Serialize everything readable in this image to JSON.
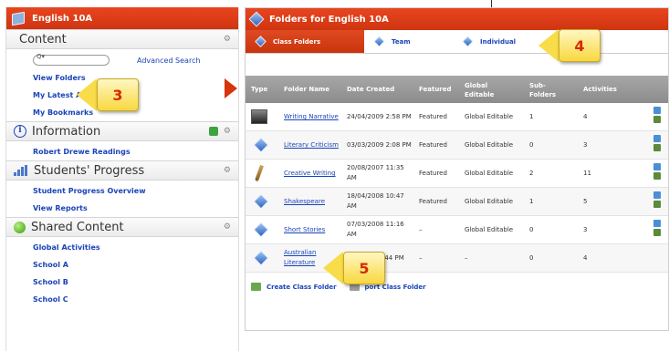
{
  "left_panel": {
    "title": "English 10A",
    "content": {
      "heading": "Content",
      "search_placeholder": "",
      "advanced_search": "Advanced Search",
      "links": [
        "View Folders",
        "My Latest Activities",
        "My Bookmarks"
      ]
    },
    "information": {
      "heading": "Information",
      "links": [
        "Robert Drewe Readings"
      ]
    },
    "progress": {
      "heading": "Students' Progress",
      "links": [
        "Student Progress Overview",
        "View Reports"
      ]
    },
    "shared": {
      "heading": "Shared Content",
      "links": [
        "Global Activities",
        "School A",
        "School B",
        "School C"
      ]
    }
  },
  "callouts": {
    "c3": "3",
    "c4": "4",
    "c5": "5"
  },
  "right_panel": {
    "title": "Folders for English 10A",
    "tabs": [
      "Class Folders",
      "Team",
      "Individual"
    ],
    "columns": {
      "type": "Type",
      "name": "Folder Name",
      "date": "Date Created",
      "featured": "Featured",
      "global1": "Global",
      "global2": "Editable",
      "sub1": "Sub-",
      "sub2": "Folders",
      "activities": "Activities"
    },
    "rows": [
      {
        "name": "Writing Narrative",
        "date": "24/04/2009 2:58 PM",
        "date2": "",
        "featured": "Featured",
        "global": "Global Editable",
        "sub": "1",
        "activities": "4",
        "icon": "image-icon"
      },
      {
        "name": "Literary Criticism",
        "date": "03/03/2009 2:08 PM",
        "date2": "",
        "featured": "Featured",
        "global": "Global Editable",
        "sub": "0",
        "activities": "3",
        "icon": "diamond-icon"
      },
      {
        "name": "Creative Writing",
        "date": "20/08/2007 11:35",
        "date2": "AM",
        "featured": "Featured",
        "global": "Global Editable",
        "sub": "2",
        "activities": "11",
        "icon": "pencil-icon"
      },
      {
        "name": "Shakespeare",
        "date": "18/04/2008 10:47",
        "date2": "AM",
        "featured": "Featured",
        "global": "Global Editable",
        "sub": "1",
        "activities": "5",
        "icon": "diamond-icon"
      },
      {
        "name": "Short Stories",
        "date": "07/03/2008 11:16",
        "date2": "AM",
        "featured": "–",
        "global": "Global Editable",
        "sub": "0",
        "activities": "3",
        "icon": "diamond-icon"
      },
      {
        "name": "Australian",
        "name2": "Literature",
        "date": ":44 PM",
        "date2": "",
        "featured": "–",
        "global": "–",
        "sub": "0",
        "activities": "4",
        "icon": "diamond-icon"
      }
    ],
    "actions": {
      "create": "Create Class Folder",
      "import": "port Class Folder"
    }
  },
  "colors": {
    "header_red": "#d83d14",
    "link_blue": "#1a44b8",
    "callout_yellow": "#f8d840"
  }
}
